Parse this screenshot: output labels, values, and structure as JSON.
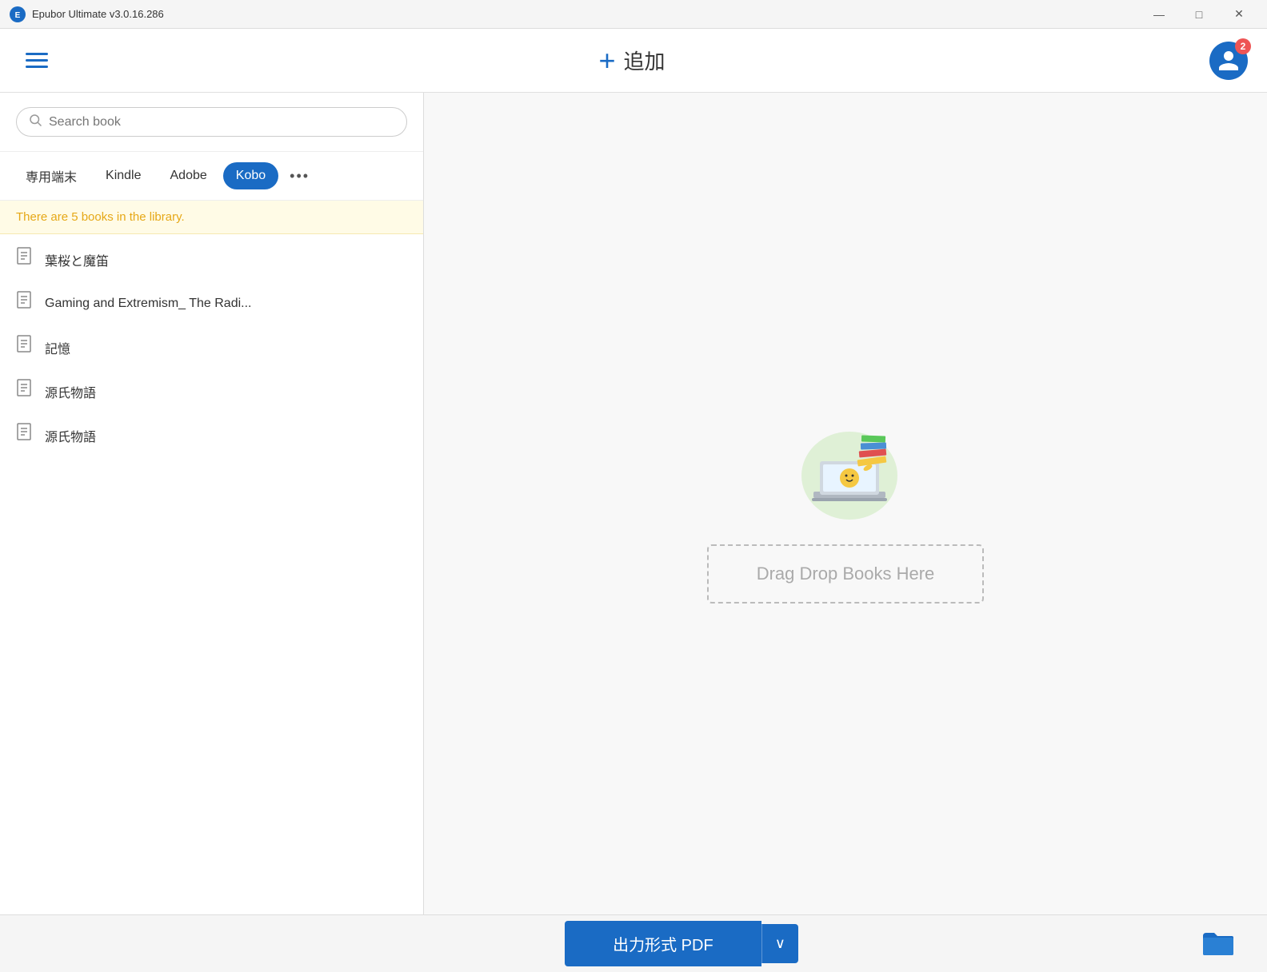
{
  "titleBar": {
    "appName": "Epubor Ultimate v3.0.16.286",
    "minimizeBtn": "—",
    "maximizeBtn": "□",
    "closeBtn": "✕"
  },
  "toolbar": {
    "addLabel": "追加",
    "addIcon": "+",
    "userBadge": "2"
  },
  "leftPanel": {
    "search": {
      "placeholder": "Search book"
    },
    "tabs": [
      {
        "label": "専用端末",
        "active": false
      },
      {
        "label": "Kindle",
        "active": false
      },
      {
        "label": "Adobe",
        "active": false
      },
      {
        "label": "Kobo",
        "active": true
      }
    ],
    "moreLabel": "•••",
    "libraryNotice": "There are 5 books in the library.",
    "books": [
      {
        "title": "葉桜と魔笛"
      },
      {
        "title": "Gaming and Extremism_ The Radi..."
      },
      {
        "title": "記憶"
      },
      {
        "title": "源氏物語"
      },
      {
        "title": "源氏物語"
      }
    ]
  },
  "rightPanel": {
    "dragDropLabel": "Drag Drop Books Here"
  },
  "bottomBar": {
    "outputLabel": "出力形式 PDF",
    "dropdownIcon": "∨"
  }
}
